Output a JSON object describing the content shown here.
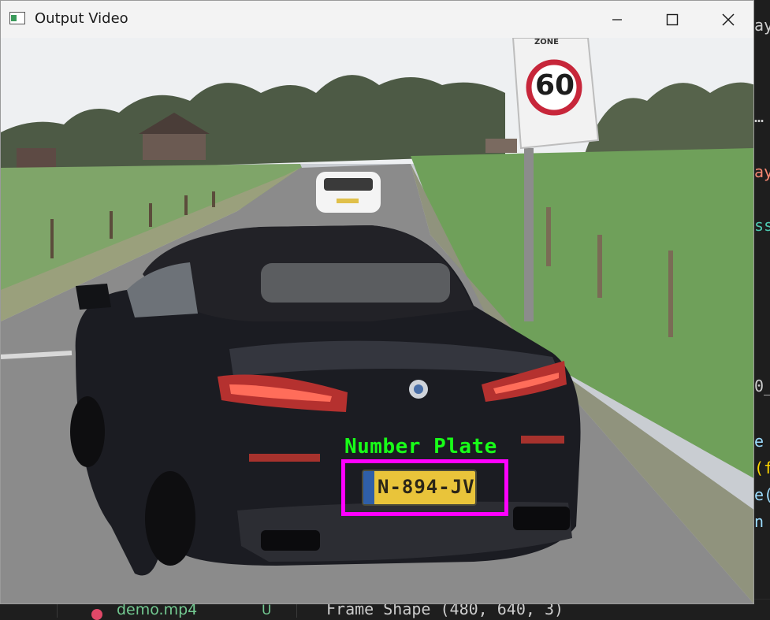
{
  "window": {
    "title": "Output Video",
    "minimize_label": "Minimize",
    "maximize_label": "Maximize",
    "close_label": "Close"
  },
  "video": {
    "detection_label": "Number Plate",
    "plate_text": "N-894-JV",
    "speed_sign": "60",
    "sign_header": "ZONE"
  },
  "background_editor": {
    "right_fragments": [
      {
        "text": "aye",
        "color": "#cccccc"
      },
      {
        "text": "…",
        "color": "#cccccc"
      },
      {
        "text": "ay",
        "color": "#f48771"
      },
      {
        "text": "ss",
        "color": "#4ec9b0"
      },
      {
        "text": "0_",
        "color": "#cccccc"
      },
      {
        "text": "e",
        "color": "#9cdcfe"
      },
      {
        "text": "(f",
        "color": "#ffd700"
      },
      {
        "text": "e(",
        "color": "#9cdcfe"
      },
      {
        "text": "n",
        "color": "#9cdcfe"
      }
    ],
    "file_name": "demo.mp4",
    "file_status": "U",
    "terminal_line": "Frame Shape (480, 640, 3)"
  },
  "colors": {
    "detection_text": "#18ff18",
    "detection_box": "#ff00ff",
    "titlebar": "#f3f3f3"
  }
}
